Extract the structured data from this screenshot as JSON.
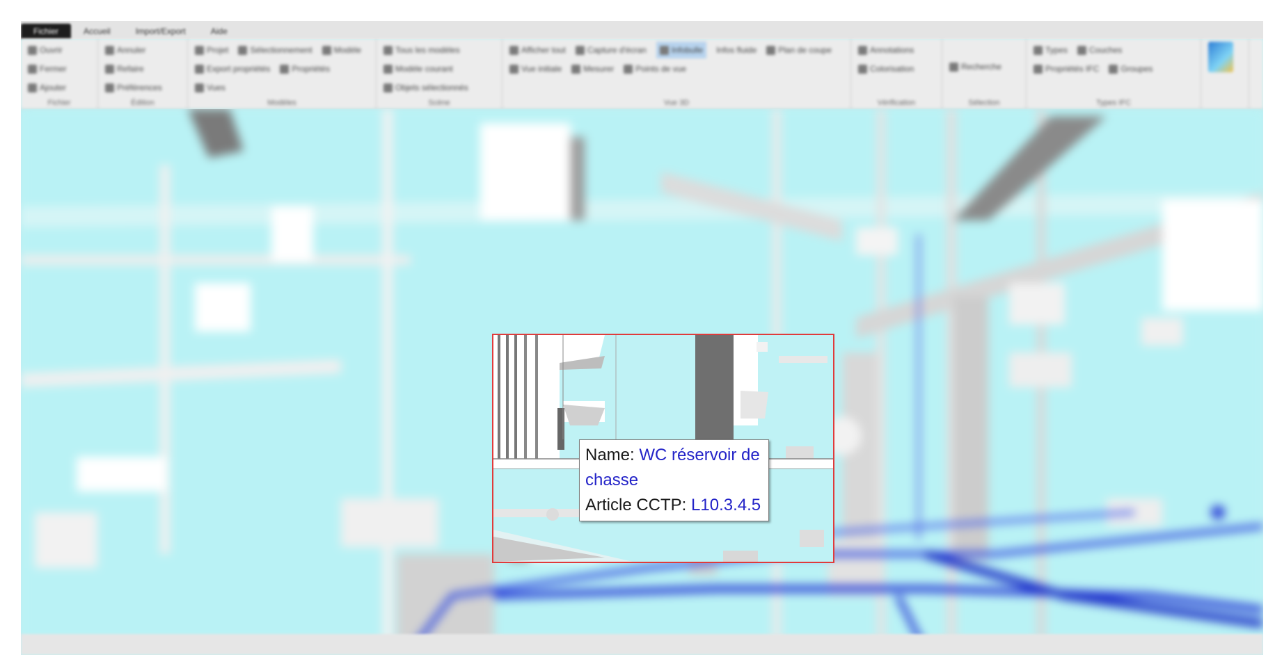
{
  "ribbon": {
    "tabs": [
      "Fichier",
      "Accueil",
      "Import/Export",
      "Aide"
    ],
    "groups": [
      {
        "title": "Fichier",
        "buttons": [
          "Ouvrir",
          "Fermer",
          "Ajouter"
        ]
      },
      {
        "title": "Édition",
        "buttons": [
          "Annuler",
          "Refaire",
          "Préférences"
        ]
      },
      {
        "title": "Modèles",
        "buttons": [
          "Projet",
          "Modèle",
          "Propriétés",
          "Sélectionnement",
          "Export propriétés",
          "Vues"
        ]
      },
      {
        "title": "Scène",
        "buttons": [
          "Tous les modèles",
          "Modèle courant",
          "Objets sélectionnés"
        ]
      },
      {
        "title": "Vue 3D",
        "buttons": [
          "Afficher tout",
          "Plan de coupe",
          "Mesurer",
          "Capture d'écran",
          "Vue initiale",
          "Points de vue"
        ],
        "highlighted": "Infobulle",
        "extra": "Infos fluide"
      },
      {
        "title": "Vérification",
        "buttons": [
          "Annotations",
          "Colorisation"
        ]
      },
      {
        "title": "Sélection",
        "buttons": [
          "Recherche"
        ]
      },
      {
        "title": "Types IFC",
        "buttons": [
          "Types",
          "Propriétés IFC",
          "Groupes",
          "Couches"
        ]
      }
    ]
  },
  "tooltip": {
    "name_label": "Name:",
    "name_value_line1": "WC réservoir de",
    "name_value_line2": "chasse",
    "article_label": "Article CCTP:",
    "article_value": "L10.3.4.5"
  },
  "colors": {
    "viewport_background": "#bff2f5",
    "pipes": "#2a3ed6",
    "inset_border": "#e03b3b",
    "tooltip_value": "#2323c8"
  }
}
